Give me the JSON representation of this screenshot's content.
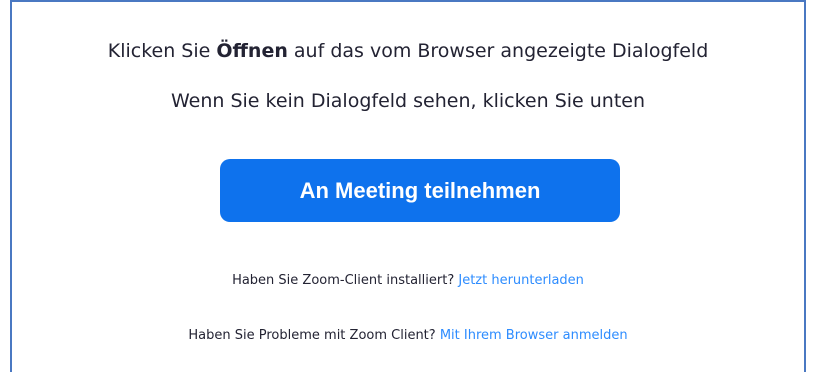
{
  "prompt": {
    "line1_prefix": "Klicken Sie",
    "line1_bold": "Öffnen",
    "line1_suffix": "auf das vom Browser angezeigte Dialogfeld",
    "line2": "Wenn Sie kein Dialogfeld sehen, klicken Sie unten"
  },
  "join_button_label": "An Meeting teilnehmen",
  "download_hint": {
    "text": "Haben Sie Zoom-Client installiert?",
    "link": "Jetzt herunterladen"
  },
  "browser_hint": {
    "text": "Haben Sie Probleme mit Zoom Client?",
    "link": "Mit Ihrem Browser anmelden"
  },
  "colors": {
    "accent": "#0e72ed",
    "link": "#2d8cff",
    "text": "#232333",
    "frame": "#4a78c2"
  }
}
